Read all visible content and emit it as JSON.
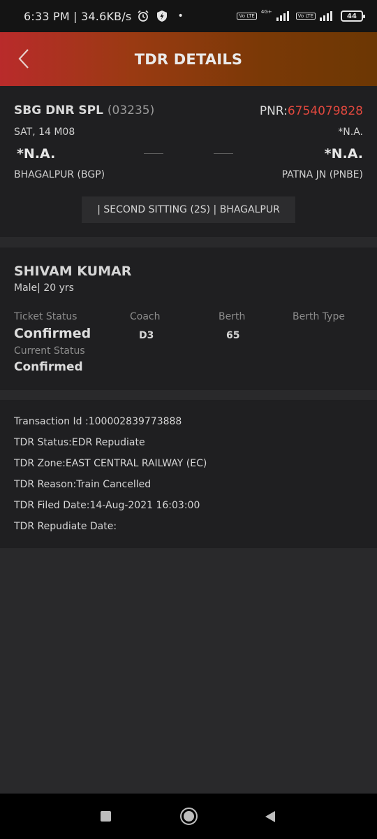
{
  "status_bar": {
    "time_speed": "6:33 PM | 34.6KB/s",
    "dot": "•",
    "volte1": "Vo LTE",
    "network": "4G+",
    "volte2": "Vo LTE",
    "battery": "44",
    "icons": [
      "alarm-icon",
      "shield-icon"
    ]
  },
  "header": {
    "title": "TDR DETAILS",
    "back_icon": "chevron-left-icon",
    "gradient": [
      "#b92b2b",
      "#6c3704"
    ]
  },
  "journey": {
    "train_name": "SBG DNR SPL",
    "train_number": "(03235)",
    "pnr_label": "PNR:",
    "pnr_value": "6754079828",
    "date": "SAT, 14 M08",
    "date_right": "*N.A.",
    "departure_time": "*N.A.",
    "arrival_time": "*N.A.",
    "from_station": "BHAGALPUR (BGP)",
    "to_station": "PATNA JN (PNBE)",
    "class_info": "| SECOND SITTING (2S) | BHAGALPUR"
  },
  "passenger": {
    "name": "SHIVAM KUMAR",
    "info": "Male| 20 yrs",
    "labels": {
      "ticket_status": "Ticket Status",
      "coach": "Coach",
      "berth": "Berth",
      "berth_type": "Berth Type",
      "current_status": "Current Status"
    },
    "ticket_status": "Confirmed",
    "coach": "D3",
    "berth": "65",
    "current_status": "Confirmed"
  },
  "tdr": {
    "transaction_id": "Transaction Id :100002839773888",
    "status": "TDR Status:EDR Repudiate",
    "zone": "TDR Zone:EAST CENTRAL RAILWAY (EC)",
    "reason": "TDR Reason:Train Cancelled",
    "filed_date": "TDR Filed Date:14-Aug-2021 16:03:00",
    "repudiate_date": "TDR Repudiate Date:"
  },
  "colors": {
    "pnr_accent": "#e0483e",
    "background": "#1f1f21"
  },
  "nav_bar": {
    "icons": [
      "recents-square-icon",
      "home-circle-icon",
      "back-triangle-icon"
    ]
  }
}
